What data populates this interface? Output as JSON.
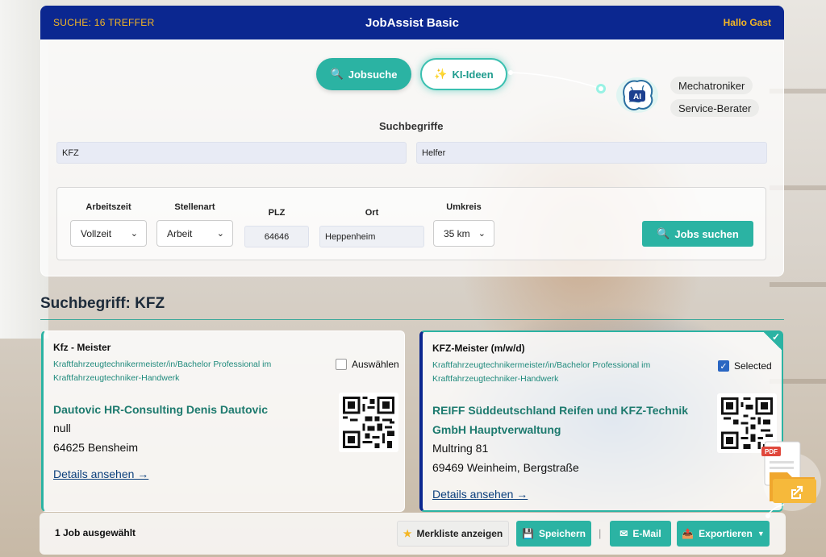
{
  "header": {
    "search_count": "SUCHE: 16 TREFFER",
    "app_title": "JobAssist Basic",
    "greeting": "Hallo Gast"
  },
  "mode_buttons": {
    "jobsuche": "Jobsuche",
    "ki_ideen": "KI-Ideen"
  },
  "ai_suggestions": {
    "badge": "AI",
    "items": [
      "Mechatroniker",
      "Service-Berater"
    ]
  },
  "search": {
    "label": "Suchbegriffe",
    "term1": "KFZ",
    "term2": "Helfer"
  },
  "filters": {
    "arbeitszeit_label": "Arbeitszeit",
    "arbeitszeit_value": "Vollzeit",
    "stellenart_label": "Stellenart",
    "stellenart_value": "Arbeit",
    "plz_label": "PLZ",
    "plz_value": "64646",
    "ort_label": "Ort",
    "ort_value": "Heppenheim",
    "umkreis_label": "Umkreis",
    "umkreis_value": "35 km",
    "submit_label": "Jobs suchen"
  },
  "results": {
    "heading": "Suchbegriff: KFZ",
    "cards": [
      {
        "title": "Kfz - Meister",
        "subtitle": "Kraftfahrzeugtechnikermeister/in/Bachelor Professional im Kraftfahrzeugtechniker-Handwerk",
        "select_label": "Auswählen",
        "selected": false,
        "company": "Dautovic HR-Consulting Denis Dautovic",
        "address_line1": "null",
        "address_line2": "64625 Bensheim",
        "details_link": "Details ansehen →"
      },
      {
        "title": "KFZ-Meister (m/w/d)",
        "subtitle": "Kraftfahrzeugtechnikermeister/in/Bachelor Professional im Kraftfahrzeugtechniker-Handwerk",
        "select_label": "Selected",
        "selected": true,
        "company": "REIFF Süddeutschland Reifen und KFZ-Technik GmbH Hauptverwaltung",
        "address_line1": "Multring 81",
        "address_line2": "69469 Weinheim, Bergstraße",
        "details_link": "Details ansehen →"
      }
    ]
  },
  "pdf_badge": "PDF",
  "footer": {
    "selected_count": "1 Job ausgewählt",
    "merkliste": "Merkliste anzeigen",
    "speichern": "Speichern",
    "separator": "|",
    "email": "E-Mail",
    "exportieren": "Exportieren"
  },
  "colors": {
    "header_bg": "#0b2790",
    "accent_teal": "#2bb3a3",
    "header_text_gold": "#f4b624"
  }
}
